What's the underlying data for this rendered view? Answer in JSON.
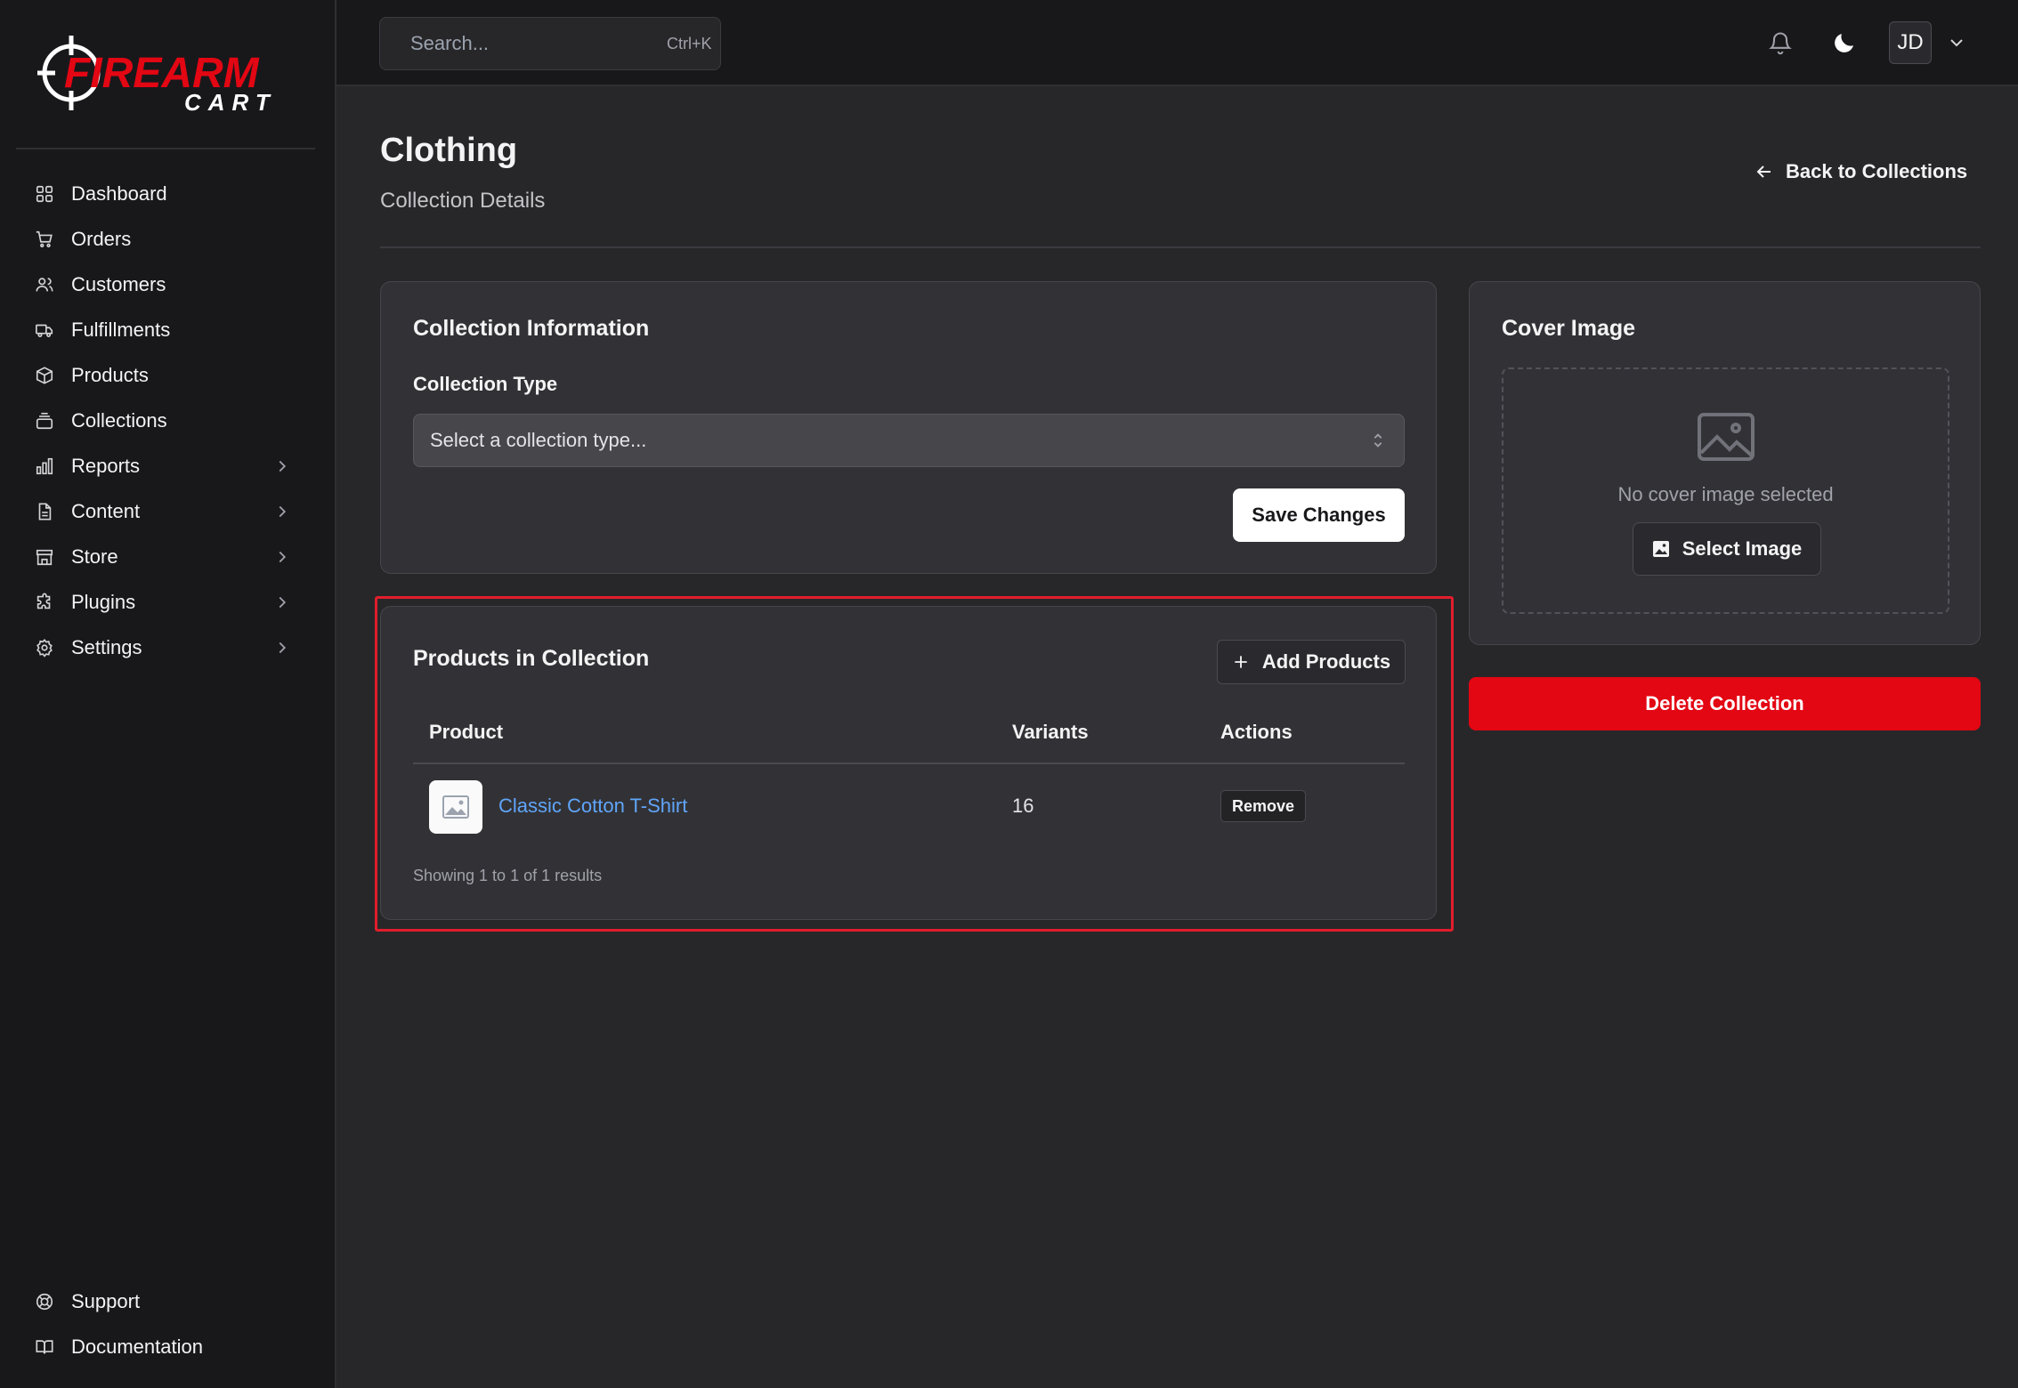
{
  "brand": {
    "logo_line1": "FIREARM",
    "logo_line2": "CART",
    "accent_color": "#e30613"
  },
  "sidebar": {
    "items": [
      {
        "label": "Dashboard",
        "icon": "dashboard-icon",
        "has_submenu": false
      },
      {
        "label": "Orders",
        "icon": "cart-icon",
        "has_submenu": false
      },
      {
        "label": "Customers",
        "icon": "users-icon",
        "has_submenu": false
      },
      {
        "label": "Fulfillments",
        "icon": "truck-icon",
        "has_submenu": false
      },
      {
        "label": "Products",
        "icon": "box-icon",
        "has_submenu": false
      },
      {
        "label": "Collections",
        "icon": "layers-icon",
        "has_submenu": false
      },
      {
        "label": "Reports",
        "icon": "bar-chart-icon",
        "has_submenu": true
      },
      {
        "label": "Content",
        "icon": "file-icon",
        "has_submenu": true
      },
      {
        "label": "Store",
        "icon": "store-icon",
        "has_submenu": true
      },
      {
        "label": "Plugins",
        "icon": "puzzle-icon",
        "has_submenu": true
      },
      {
        "label": "Settings",
        "icon": "gear-icon",
        "has_submenu": true
      }
    ],
    "bottom_items": [
      {
        "label": "Support",
        "icon": "lifebuoy-icon"
      },
      {
        "label": "Documentation",
        "icon": "book-icon"
      }
    ]
  },
  "topbar": {
    "search_placeholder": "Search...",
    "search_shortcut": "Ctrl+K",
    "avatar_initials": "JD"
  },
  "page": {
    "title": "Clothing",
    "subtitle": "Collection Details",
    "back_label": "Back to Collections"
  },
  "collection_info": {
    "title": "Collection Information",
    "type_label": "Collection Type",
    "type_placeholder": "Select a collection type...",
    "save_label": "Save Changes"
  },
  "products": {
    "title": "Products in Collection",
    "add_label": "Add Products",
    "columns": [
      "Product",
      "Variants",
      "Actions"
    ],
    "rows": [
      {
        "name": "Classic Cotton T-Shirt",
        "variants": "16",
        "action": "Remove"
      }
    ],
    "results_text": "Showing 1 to 1 of 1 results"
  },
  "cover": {
    "title": "Cover Image",
    "empty_text": "No cover image selected",
    "select_label": "Select Image"
  },
  "delete_label": "Delete Collection"
}
